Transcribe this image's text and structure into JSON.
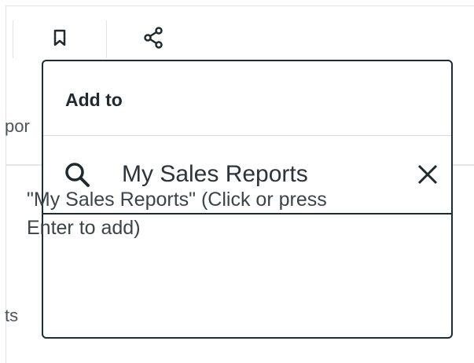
{
  "background": {
    "partial_text_1": "por",
    "partial_text_2": "ts"
  },
  "toolbar": {
    "bookmark_icon": "bookmark-icon",
    "share_icon": "share-icon"
  },
  "popover": {
    "title": "Add to",
    "search": {
      "value": "My Sales Reports",
      "placeholder": ""
    },
    "suggestion": "\"My Sales Reports\" (Click or press Enter to add)"
  },
  "colors": {
    "border": "#1d2d35",
    "text": "#1f2a30",
    "divider": "#d7dbde"
  }
}
